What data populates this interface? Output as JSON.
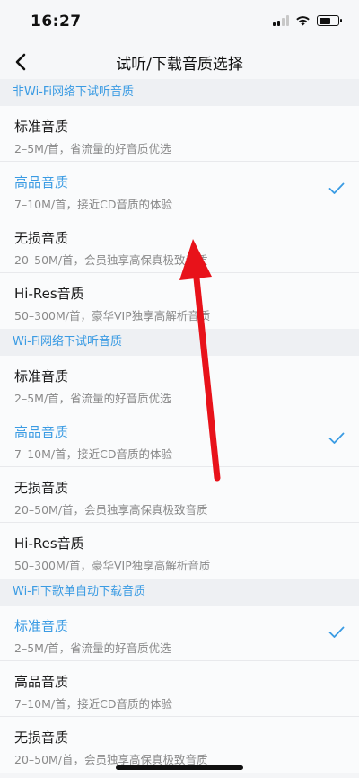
{
  "status_bar": {
    "time": "16:27"
  },
  "nav": {
    "title": "试听/下载音质选择"
  },
  "sections": [
    {
      "header": "非Wi-Fi网络下试听音质",
      "options": [
        {
          "name": "标准音质",
          "desc": "2–5M/首，省流量的好音质优选",
          "selected": false
        },
        {
          "name": "高品音质",
          "desc": "7–10M/首，接近CD音质的体验",
          "selected": true
        },
        {
          "name": "无损音质",
          "desc": "20–50M/首，会员独享高保真极致音质",
          "selected": false
        },
        {
          "name": "Hi-Res音质",
          "desc": "50–300M/首，豪华VIP独享高解析音质",
          "selected": false
        }
      ]
    },
    {
      "header": "Wi-Fi网络下试听音质",
      "options": [
        {
          "name": "标准音质",
          "desc": "2–5M/首，省流量的好音质优选",
          "selected": false
        },
        {
          "name": "高品音质",
          "desc": "7–10M/首，接近CD音质的体验",
          "selected": true
        },
        {
          "name": "无损音质",
          "desc": "20–50M/首，会员独享高保真极致音质",
          "selected": false
        },
        {
          "name": "Hi-Res音质",
          "desc": "50–300M/首，豪华VIP独享高解析音质",
          "selected": false
        }
      ]
    },
    {
      "header": "Wi-Fi下歌单自动下载音质",
      "options": [
        {
          "name": "标准音质",
          "desc": "2–5M/首，省流量的好音质优选",
          "selected": true
        },
        {
          "name": "高品音质",
          "desc": "7–10M/首，接近CD音质的体验",
          "selected": false
        },
        {
          "name": "无损音质",
          "desc": "20–50M/首，会员独享高保真极致音质",
          "selected": false
        }
      ]
    }
  ],
  "colors": {
    "accent": "#3a9be3",
    "arrow": "#e8121a"
  },
  "icons": {
    "back": "chevron-left-icon",
    "check": "check-icon",
    "annotation": "red-arrow"
  }
}
